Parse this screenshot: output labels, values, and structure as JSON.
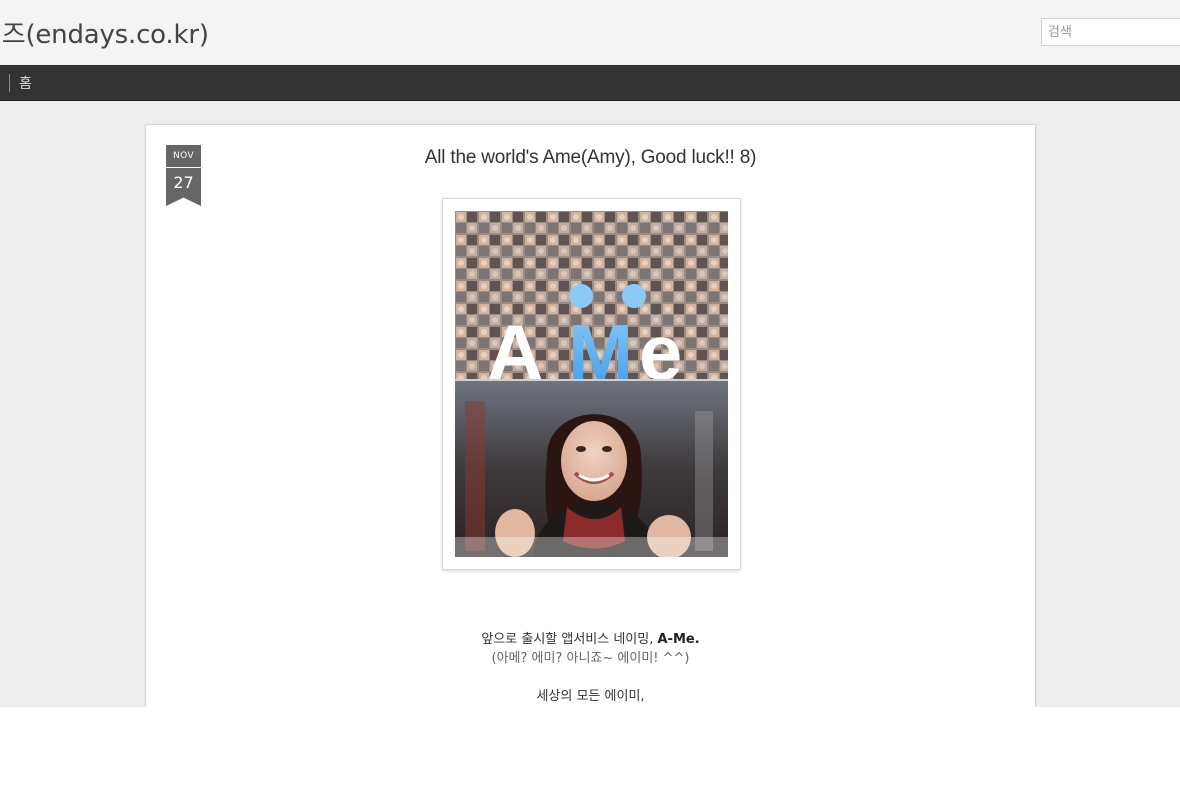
{
  "header": {
    "blog_title": "이즈(endays.co.kr)",
    "search_placeholder": "검색"
  },
  "nav": {
    "home_label": "홈"
  },
  "post": {
    "date_month": "NOV",
    "date_day": "27",
    "title": "All the world's Ame(Amy), Good luck!! 8)",
    "image_text": {
      "logo_a": "A",
      "logo_m": "M",
      "logo_e": "e"
    },
    "body": {
      "line1_text": "앞으로 출시할 앱서비스 네이밍, ",
      "line1_bold": "A-Me.",
      "line2": "(아메? 에미? 아니죠~ 에이미! ^^)",
      "line3": "세상의 모든 에이미,"
    }
  },
  "colors": {
    "navbar": "#333333",
    "logo_blue": "#3d9be9",
    "page_background": "#eeeeee"
  }
}
